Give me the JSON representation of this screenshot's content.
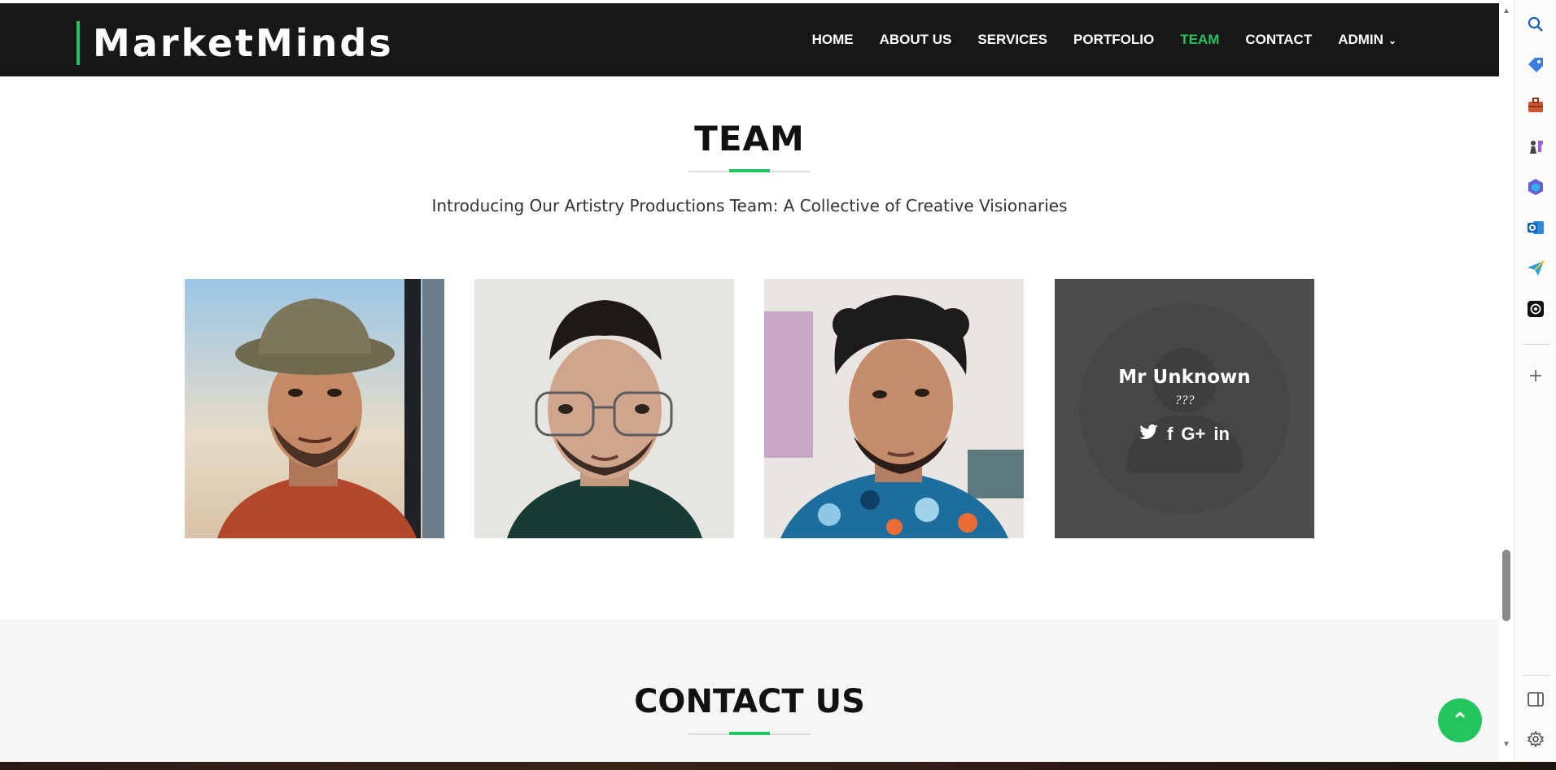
{
  "brand": {
    "name": "MarketMinds"
  },
  "nav": {
    "items": [
      "HOME",
      "ABOUT US",
      "SERVICES",
      "PORTFOLIO",
      "TEAM",
      "CONTACT",
      "ADMIN"
    ],
    "active": "TEAM"
  },
  "team": {
    "title": "TEAM",
    "subtitle": "Introducing Our Artistry Productions Team: A Collective of Creative Visionaries",
    "members": [
      {
        "photo": "photo-bucket-hat"
      },
      {
        "photo": "photo-glasses"
      },
      {
        "photo": "photo-curly-hair"
      },
      {
        "name": "Mr Unknown",
        "role": "???",
        "social": [
          "twitter-icon",
          "facebook-icon",
          "google-plus-icon",
          "linkedin-icon"
        ]
      }
    ]
  },
  "contact": {
    "title": "CONTACT US"
  },
  "colors": {
    "accent": "#22c55e",
    "navbar": "#171717",
    "contact_bg": "#f6f6f6"
  }
}
